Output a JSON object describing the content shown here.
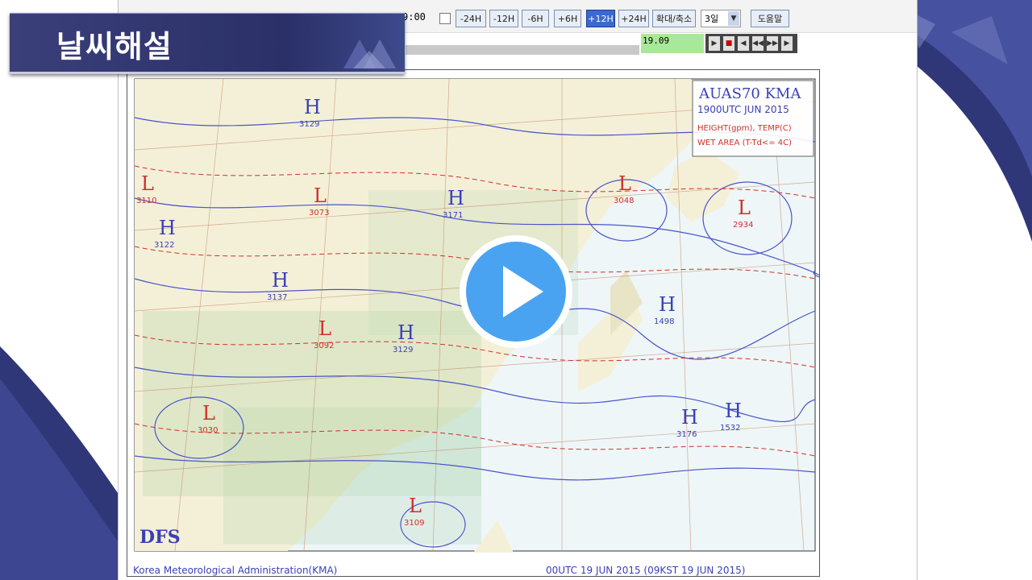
{
  "slide": {
    "title": "날씨해설"
  },
  "toolbar": {
    "time_text": "9:00",
    "buttons": [
      {
        "label": "-24H",
        "active": false
      },
      {
        "label": "-12H",
        "active": false
      },
      {
        "label": "-6H",
        "active": false
      },
      {
        "label": "+6H",
        "active": false
      },
      {
        "label": "+12H",
        "active": true
      },
      {
        "label": "+24H",
        "active": false
      }
    ],
    "zoom_label": "확대/축소",
    "days_select": "3일",
    "help_label": "도움말",
    "slider_value": "19.09"
  },
  "chart": {
    "header_line1": "AUAS70 KMA",
    "header_line2": "1900UTC JUN 2015",
    "legend_line1": "HEIGHT(gpm), TEMP(C)",
    "legend_line2": "WET AREA (T-Td<= 4C)",
    "logo": "DFS",
    "footer_left": "Korea Meteorological Administration(KMA)",
    "footer_right": "00UTC 19 JUN 2015 (09KST 19 JUN 2015)",
    "systems": [
      {
        "symbol": "H",
        "value": "3129",
        "color": "#3a3fb8"
      },
      {
        "symbol": "L",
        "value": "3110",
        "color": "#d0302a"
      },
      {
        "symbol": "H",
        "value": "3122",
        "color": "#3a3fb8"
      },
      {
        "symbol": "L",
        "value": "3073",
        "color": "#d0302a"
      },
      {
        "symbol": "H",
        "value": "3171",
        "color": "#3a3fb8"
      },
      {
        "symbol": "H",
        "value": "3137",
        "color": "#3a3fb8"
      },
      {
        "symbol": "L",
        "value": "3092",
        "color": "#d0302a"
      },
      {
        "symbol": "H",
        "value": "3129",
        "color": "#3a3fb8"
      },
      {
        "symbol": "L",
        "value": "3048",
        "color": "#d0302a"
      },
      {
        "symbol": "L",
        "value": "2934",
        "color": "#d0302a"
      },
      {
        "symbol": "H",
        "value": "1498",
        "color": "#3a3fb8"
      },
      {
        "symbol": "H",
        "value": "3176",
        "color": "#3a3fb8"
      },
      {
        "symbol": "H",
        "value": "1532",
        "color": "#3a3fb8"
      },
      {
        "symbol": "L",
        "value": "3030",
        "color": "#d0302a"
      },
      {
        "symbol": "L",
        "value": "3109",
        "color": "#d0302a"
      }
    ]
  },
  "video": {
    "play_icon": "play-icon"
  }
}
